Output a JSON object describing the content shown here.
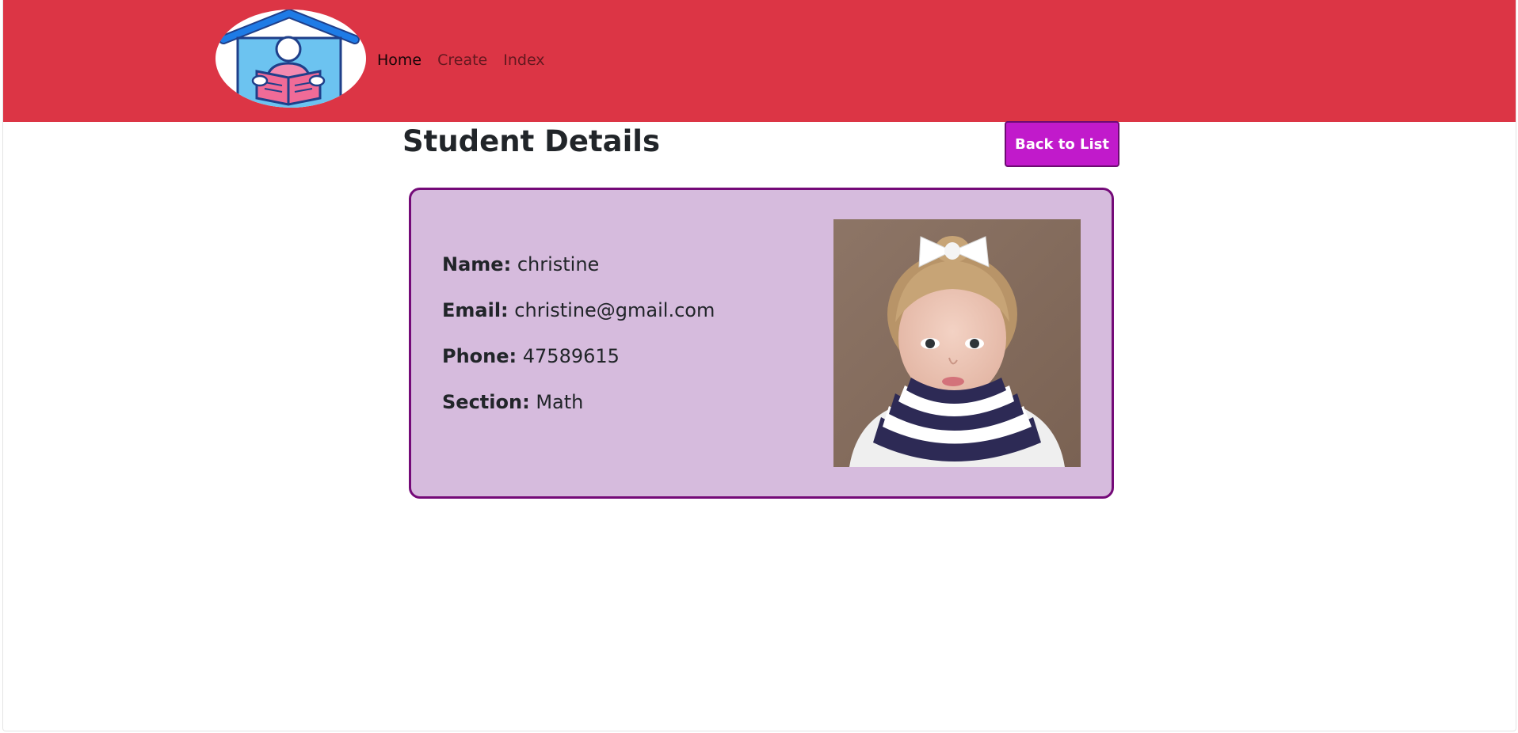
{
  "nav": {
    "links": [
      {
        "label": "Home",
        "active": true
      },
      {
        "label": "Create",
        "active": false
      },
      {
        "label": "Index",
        "active": false
      }
    ],
    "logo_icon": "house-reader-icon"
  },
  "page": {
    "title": "Student Details",
    "back_button_label": "Back to List"
  },
  "student": {
    "fields": [
      {
        "label": "Name:",
        "value": "christine"
      },
      {
        "label": "Email:",
        "value": "christine@gmail.com"
      },
      {
        "label": "Phone:",
        "value": "47589615"
      },
      {
        "label": "Section:",
        "value": "Math"
      }
    ]
  },
  "colors": {
    "navbar": "#dc3545",
    "button": "#c11acb",
    "card_bg": "#d6bbdd",
    "card_border": "#740a78"
  }
}
